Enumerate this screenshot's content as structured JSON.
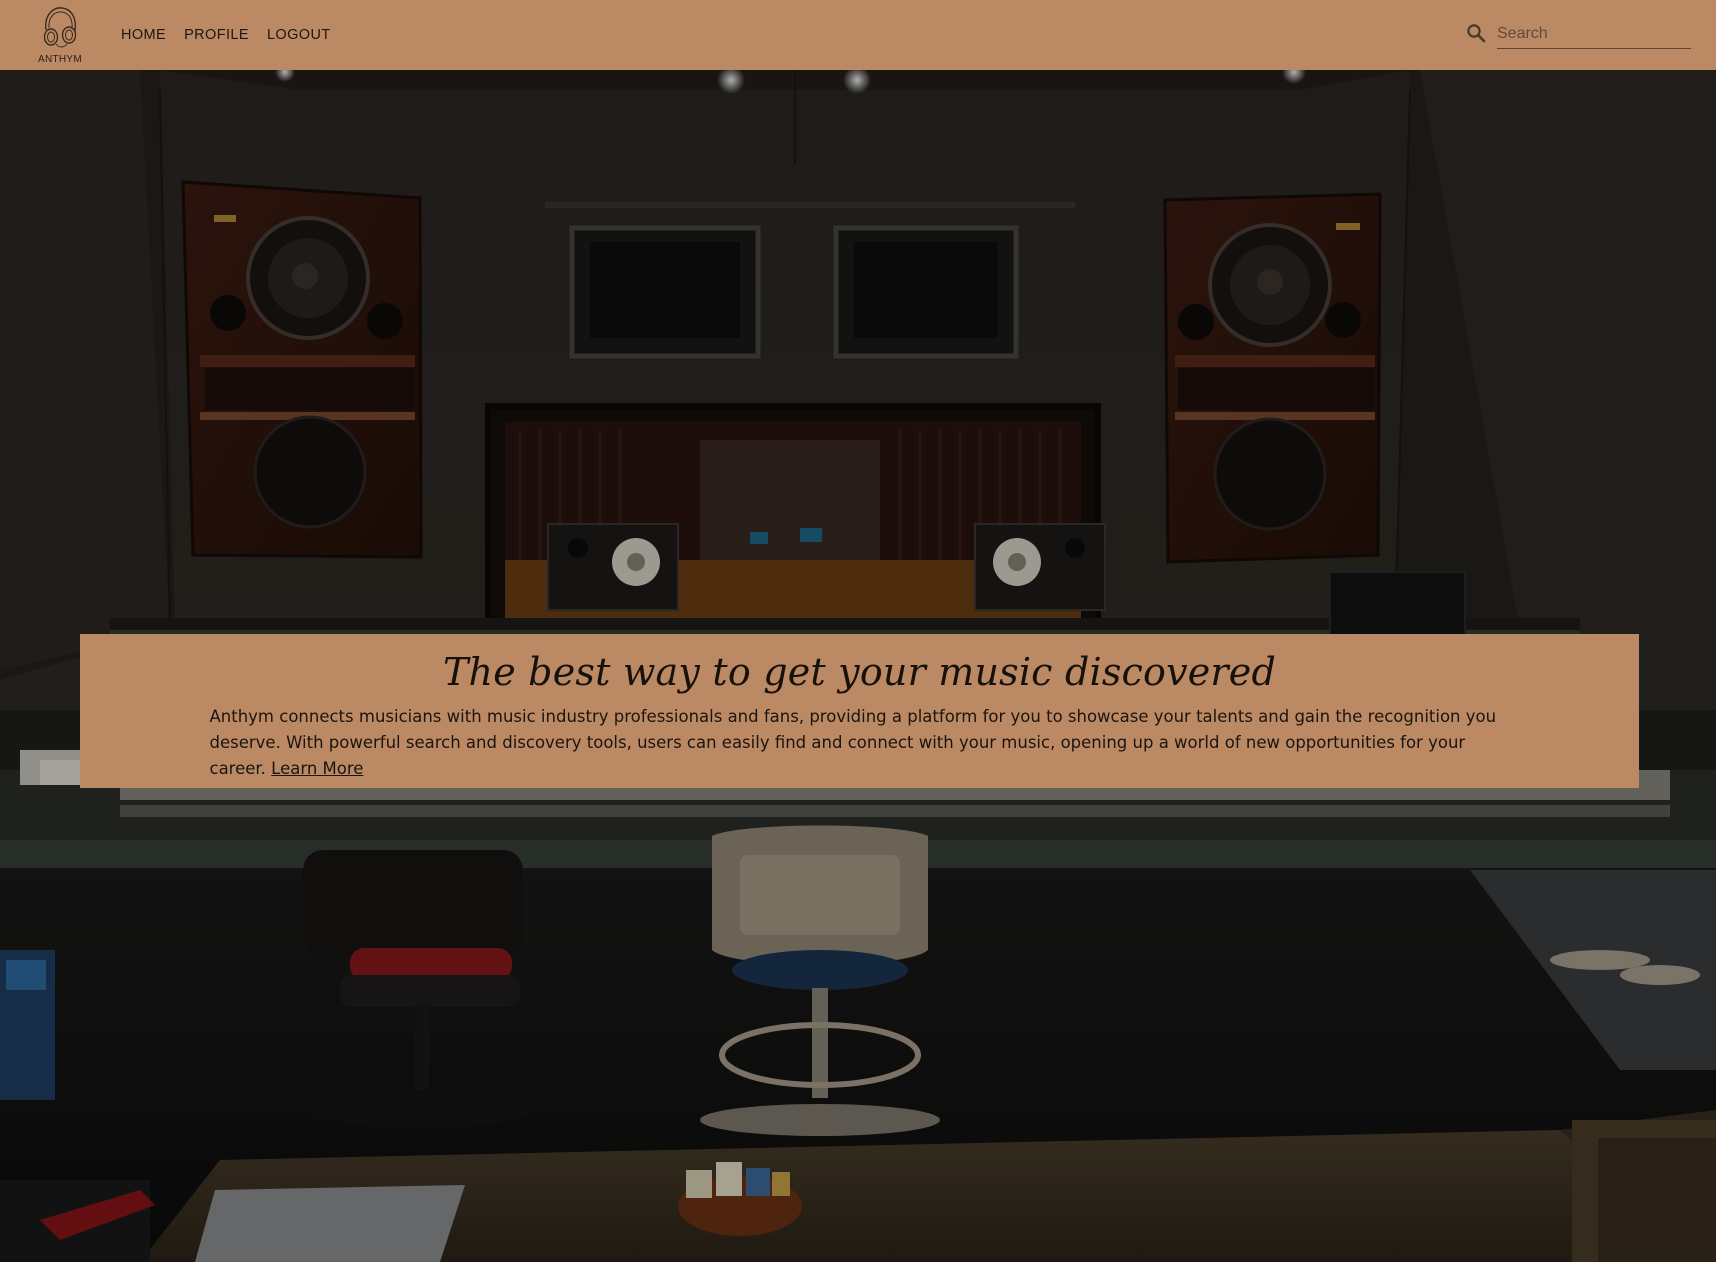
{
  "nav": {
    "logo_text": "ANTHYM",
    "links": [
      "HOME",
      "PROFILE",
      "LOGOUT"
    ],
    "search": {
      "placeholder": "Search",
      "value": ""
    }
  },
  "hero": {
    "headline": "The best way to get your music discovered",
    "line1": "Anthym connects musicians with music industry professionals and fans, providing a platform for you to showcase your talents and gain the recognition you deserve.",
    "line2": "With powerful search and discovery tools, users can easily find and connect with your music, opening up a world of new opportunities for your career.",
    "link_text": "Learn More"
  },
  "colors": {
    "nav_background": "#bb8a64",
    "callout_background": "#bb8a64",
    "text_dark": "#1c140e"
  },
  "icons": {
    "logo": "headphones-icon",
    "search": "search-icon"
  }
}
